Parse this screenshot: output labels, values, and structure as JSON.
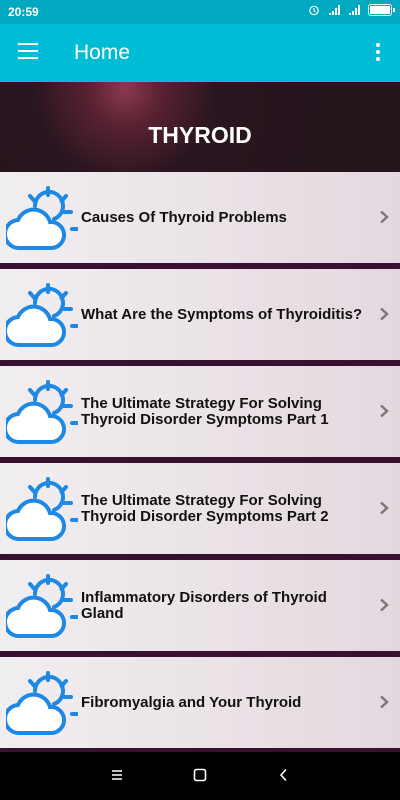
{
  "status_bar": {
    "time": "20:59",
    "battery_level": 0.9
  },
  "app_bar": {
    "title": "Home",
    "menu_icon": "hamburger-menu-icon",
    "overflow_icon": "more-vert-icon"
  },
  "banner": {
    "heading": "THYROID"
  },
  "articles": [
    {
      "title": "Causes Of Thyroid Problems",
      "icon": "sun-cloud-icon"
    },
    {
      "title": "What Are the Symptoms of Thyroiditis?",
      "icon": "sun-cloud-icon"
    },
    {
      "title": "The Ultimate Strategy For Solving Thyroid Disorder Symptoms Part 1",
      "icon": "sun-cloud-icon"
    },
    {
      "title": "The Ultimate Strategy For Solving Thyroid Disorder Symptoms Part 2",
      "icon": "sun-cloud-icon"
    },
    {
      "title": "Inflammatory Disorders of Thyroid Gland",
      "icon": "sun-cloud-icon"
    },
    {
      "title": "Fibromyalgia and Your Thyroid",
      "icon": "sun-cloud-icon"
    }
  ],
  "colors": {
    "app_bar": "#00bcd4",
    "status_bar": "#00a8c0",
    "icon_blue": "#1e88e5",
    "separator": "#3a1030"
  }
}
